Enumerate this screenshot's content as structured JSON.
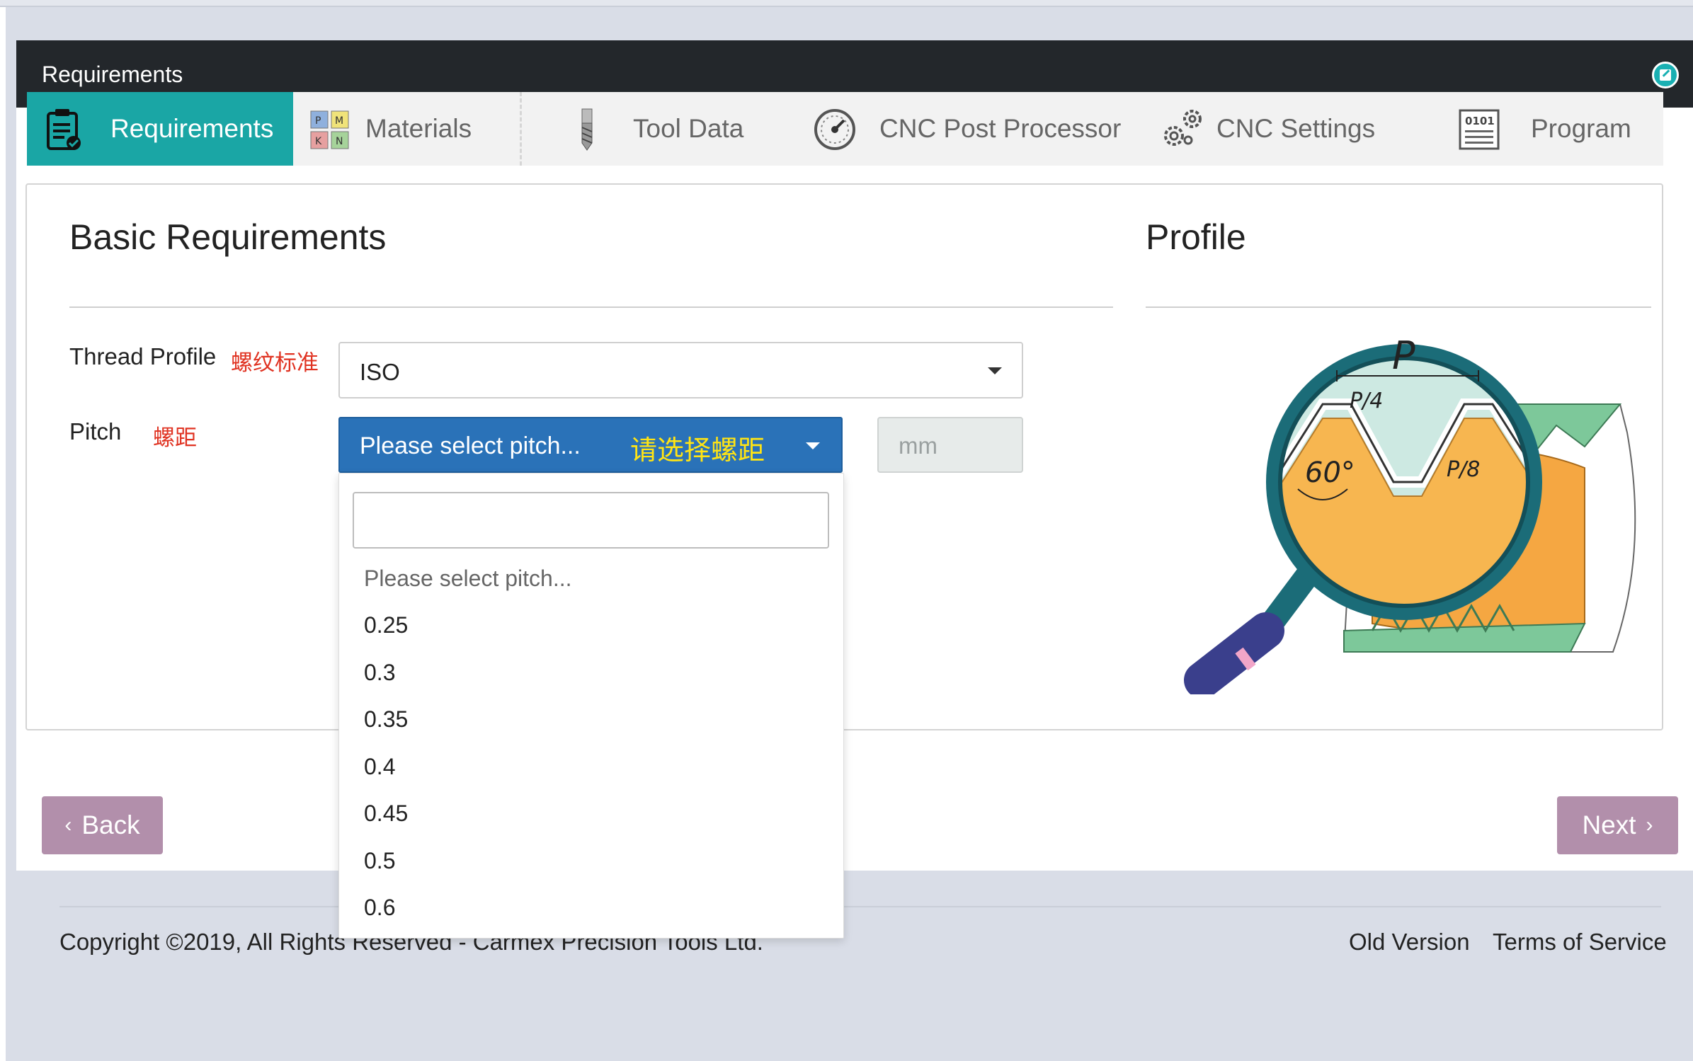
{
  "header": {
    "title": "Requirements"
  },
  "tabs": [
    {
      "label": "Requirements",
      "icon": "clipboard-check-icon",
      "active": true
    },
    {
      "label": "Materials",
      "icon": "pmkn-grid-icon",
      "active": false
    },
    {
      "label": "Tool Data",
      "icon": "drill-bit-icon",
      "active": false
    },
    {
      "label": "CNC Post Processor",
      "icon": "gauge-icon",
      "active": false
    },
    {
      "label": "CNC Settings",
      "icon": "gears-icon",
      "active": false
    },
    {
      "label": "Program",
      "icon": "program-window-icon",
      "active": false
    }
  ],
  "materials_grid": [
    "P",
    "M",
    "K",
    "N"
  ],
  "program_icon_text": "0101",
  "basic": {
    "title": "Basic Requirements",
    "thread_profile_label": "Thread Profile",
    "thread_profile_cn": "螺纹标准",
    "thread_profile_value": "ISO",
    "pitch_label": "Pitch",
    "pitch_cn": "螺距",
    "pitch_value": "Please select pitch...",
    "pitch_cn_hint": "请选择螺距",
    "unit_placeholder": "mm"
  },
  "profile": {
    "title": "Profile",
    "diagram_labels": {
      "pitch": "P",
      "quarter": "P/4",
      "angle": "60°",
      "eighth": "P/8"
    }
  },
  "dropdown": {
    "search_value": "",
    "options": [
      "Please select pitch...",
      "0.25",
      "0.3",
      "0.35",
      "0.4",
      "0.45",
      "0.5",
      "0.6"
    ]
  },
  "buttons": {
    "back": "Back",
    "next": "Next"
  },
  "footer": {
    "copyright": "Copyright ©2019, All Rights Reserved - Carmex Precision Tools Ltd.",
    "links": [
      "Old Version",
      "Terms of Service"
    ]
  },
  "colors": {
    "accent": "#1aa6a5",
    "select_blue": "#2a72b8",
    "nav_button": "#b28fab",
    "header_dark": "#23272b"
  }
}
